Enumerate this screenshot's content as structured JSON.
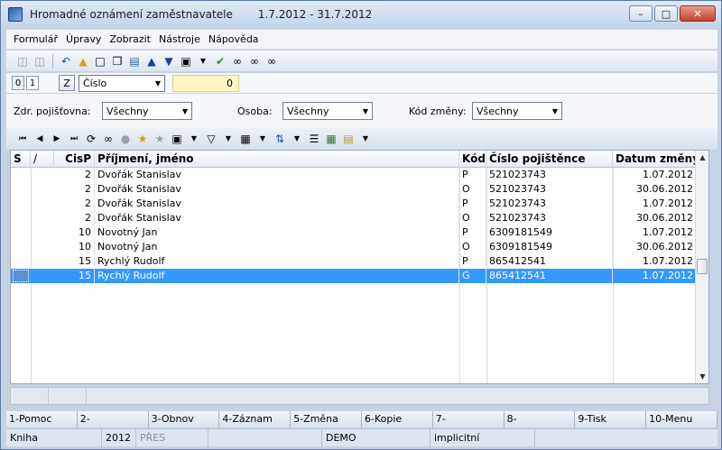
{
  "window": {
    "title": "Hromadné oznámení zaměstnavatele",
    "date_range": "1.7.2012 - 31.7.2012",
    "min_icon": "minimize-icon",
    "max_icon": "maximize-icon",
    "close_icon": "close-icon"
  },
  "menu": {
    "items": [
      {
        "label": "Formulář"
      },
      {
        "label": "Úpravy"
      },
      {
        "label": "Zobrazit"
      },
      {
        "label": "Nástroje"
      },
      {
        "label": "Nápověda"
      }
    ]
  },
  "toolbar_main": {
    "icons": [
      "save-icon",
      "save-as-icon",
      "undo-icon",
      "open-folder-icon",
      "new-document-icon",
      "copy-icon",
      "book-icon",
      "arrow-up-icon",
      "arrow-down-icon",
      "camera-icon",
      "dropdown-arrow-icon",
      "run-icon",
      "binoculars-icon",
      "binoculars-next-icon",
      "binoculars-prev-icon"
    ]
  },
  "tabs": {
    "tab0": "0",
    "tab1": "1",
    "z_button": "Z",
    "sort_field": "Číslo",
    "sort_value": "0"
  },
  "filters": {
    "zdr_label": "Zdr. pojišťovna:",
    "zdr_value": "Všechny",
    "osoba_label": "Osoba:",
    "osoba_value": "Všechny",
    "kod_label": "Kód změny:",
    "kod_value": "Všechny"
  },
  "toolbar_grid": {
    "icons": [
      "first-record-icon",
      "prev-record-icon",
      "next-record-icon",
      "last-record-icon",
      "refresh-icon",
      "find-icon",
      "lock-icon",
      "add-star-icon",
      "remove-icon",
      "camera-icon",
      "dropdown-arrow-icon",
      "filter-icon",
      "dropdown-arrow-icon",
      "columns-icon",
      "dropdown-arrow-icon",
      "sort-az-icon",
      "dropdown-arrow-icon",
      "list-icon",
      "excel-icon",
      "report-icon",
      "dropdown-arrow-icon"
    ]
  },
  "grid": {
    "headers": {
      "s": "S",
      "mark": "/",
      "cisp": "CisP",
      "name": "Příjmení, jméno",
      "kod": "Kód",
      "cislo": "Číslo pojištěnce",
      "datum": "Datum změny"
    },
    "rows": [
      {
        "cisp": "2",
        "name": "Dvořák Stanislav",
        "kod": "P",
        "cislo": "521023743",
        "datum": "1.07.2012"
      },
      {
        "cisp": "2",
        "name": "Dvořák Stanislav",
        "kod": "O",
        "cislo": "521023743",
        "datum": "30.06.2012"
      },
      {
        "cisp": "2",
        "name": "Dvořák Stanislav",
        "kod": "P",
        "cislo": "521023743",
        "datum": "1.07.2012"
      },
      {
        "cisp": "2",
        "name": "Dvořák Stanislav",
        "kod": "O",
        "cislo": "521023743",
        "datum": "30.06.2012"
      },
      {
        "cisp": "10",
        "name": "Novotný Jan",
        "kod": "P",
        "cislo": "6309181549",
        "datum": "1.07.2012"
      },
      {
        "cisp": "10",
        "name": "Novotný Jan",
        "kod": "O",
        "cislo": "6309181549",
        "datum": "30.06.2012"
      },
      {
        "cisp": "15",
        "name": "Rychlý Rudolf",
        "kod": "P",
        "cislo": "865412541",
        "datum": "1.07.2012"
      },
      {
        "cisp": "15",
        "name": "Rychlý Rudolf",
        "kod": "G",
        "cislo": "865412541",
        "datum": "1.07.2012"
      }
    ],
    "selected_row": 7
  },
  "fkeys": [
    "1-Pomoc",
    "2-",
    "3-Obnov",
    "4-Záznam",
    "5-Změna",
    "6-Kopie",
    "7-",
    "8-",
    "9-Tisk",
    "10-Menu"
  ],
  "status": {
    "book": "Kniha",
    "year": "2012",
    "mode": "PŘES",
    "db": "DEMO",
    "profile": "implicitní"
  },
  "colors": {
    "selection": "#3399ff",
    "title_bg": "#c3d4ea",
    "sort_value_bg": "#fff7c2"
  }
}
